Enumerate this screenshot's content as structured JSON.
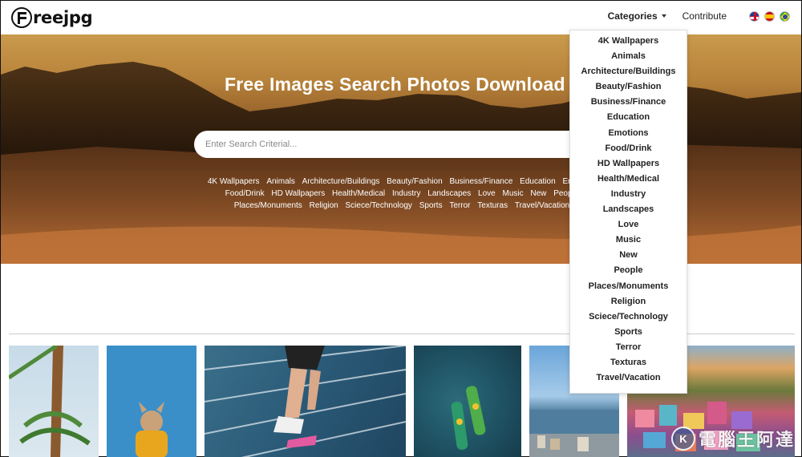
{
  "brand": {
    "logo_text": "reejpg"
  },
  "nav": {
    "categories_label": "Categories",
    "contribute_label": "Contribute",
    "flags": [
      "uk-flag-icon",
      "spain-flag-icon",
      "brazil-flag-icon"
    ]
  },
  "hero": {
    "title": "Free Images Search Photos Download",
    "search_placeholder": "Enter Search Criterial...",
    "tags": [
      "4K Wallpapers",
      "Animals",
      "Architecture/Buildings",
      "Beauty/Fashion",
      "Business/Finance",
      "Education",
      "Emotions",
      "Food/Drink",
      "HD Wallpapers",
      "Health/Medical",
      "Industry",
      "Landscapes",
      "Love",
      "Music",
      "New",
      "People",
      "Places/Monuments",
      "Religion",
      "Sciece/Technology",
      "Sports",
      "Terror",
      "Texturas",
      "Travel/Vacation"
    ]
  },
  "dropdown": {
    "items": [
      "4K Wallpapers",
      "Animals",
      "Architecture/Buildings",
      "Beauty/Fashion",
      "Business/Finance",
      "Education",
      "Emotions",
      "Food/Drink",
      "HD Wallpapers",
      "Health/Medical",
      "Industry",
      "Landscapes",
      "Love",
      "Music",
      "New",
      "People",
      "Places/Monuments",
      "Religion",
      "Sciece/Technology",
      "Sports",
      "Terror",
      "Texturas",
      "Travel/Vacation"
    ]
  },
  "photos": [
    "palm-tree-photo",
    "dog-photo",
    "runner-photo",
    "kayaks-photo",
    "harbor-photo",
    "colorful-town-photo"
  ],
  "watermark": {
    "text": "電腦王阿達",
    "symbol": "K"
  },
  "colors": {
    "accent": "#111111",
    "hero_dark": "#2a1a0c",
    "hero_light": "#c99a4c"
  }
}
